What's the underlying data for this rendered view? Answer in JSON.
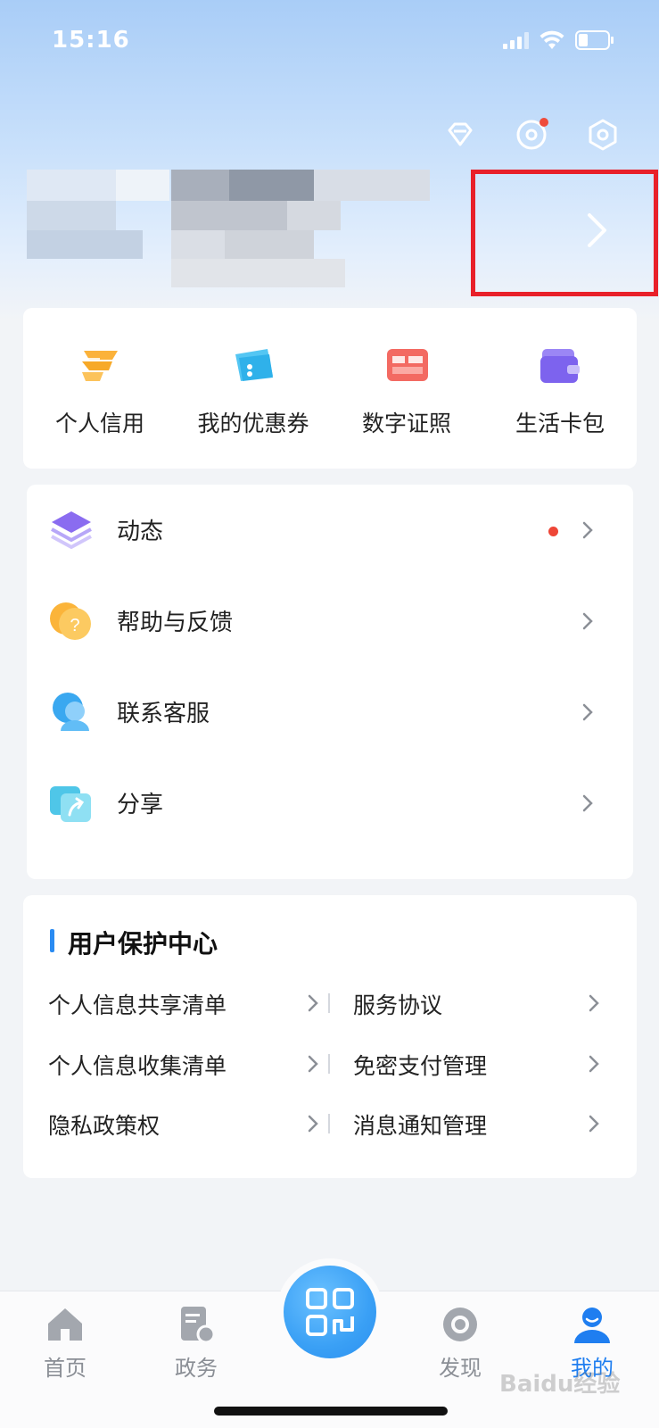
{
  "status_bar": {
    "time": "15:16"
  },
  "quick_access": [
    {
      "label": "个人信用",
      "icon": "credit-icon",
      "color": "#f7a928"
    },
    {
      "label": "我的优惠券",
      "icon": "coupon-icon",
      "color": "#3ab7ee"
    },
    {
      "label": "数字证照",
      "icon": "license-icon",
      "color": "#f0635c"
    },
    {
      "label": "生活卡包",
      "icon": "wallet-icon",
      "color": "#7d63ee"
    }
  ],
  "menu": [
    {
      "label": "动态",
      "icon": "layers-icon",
      "has_dot": true
    },
    {
      "label": "帮助与反馈",
      "icon": "help-icon",
      "has_dot": false
    },
    {
      "label": "联系客服",
      "icon": "customer-service-icon",
      "has_dot": false
    },
    {
      "label": "分享",
      "icon": "share-icon",
      "has_dot": false
    }
  ],
  "protection": {
    "title": "用户保护中心",
    "links": [
      [
        "个人信息共享清单",
        "服务协议"
      ],
      [
        "个人信息收集清单",
        "免密支付管理"
      ],
      [
        "隐私政策权",
        "消息通知管理"
      ]
    ]
  },
  "tabbar": {
    "tabs": [
      {
        "label": "首页",
        "icon": "home-icon",
        "active": false
      },
      {
        "label": "政务",
        "icon": "government-icon",
        "active": false
      },
      {
        "label": "发现",
        "icon": "discover-icon",
        "active": false
      },
      {
        "label": "我的",
        "icon": "profile-icon",
        "active": true
      }
    ],
    "center_icon": "scan-icon"
  },
  "colors": {
    "accent": "#1f7ef0",
    "highlight_border": "#e8202a",
    "notification_dot": "#ee4637"
  },
  "watermark": "Baidu经验"
}
